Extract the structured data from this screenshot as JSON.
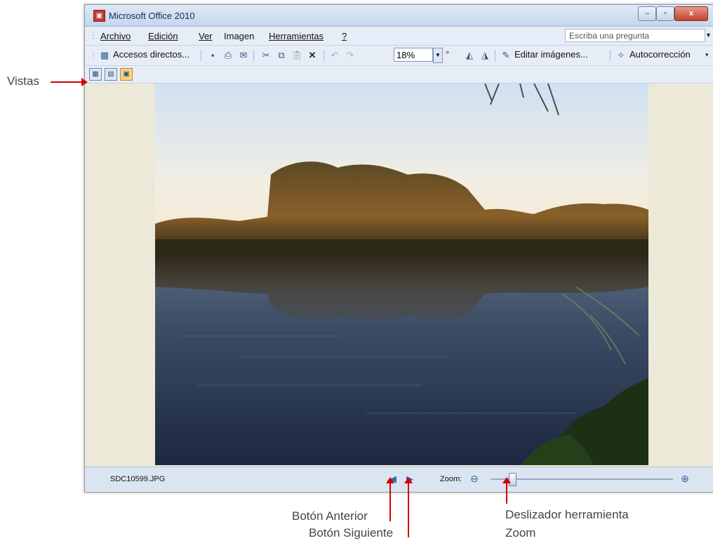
{
  "window": {
    "title": "Microsoft Office 2010",
    "app_icon_glyph": "▣",
    "controls": {
      "minimize": "–",
      "maximize": "▫",
      "close": "x"
    }
  },
  "menu": {
    "items": [
      {
        "label": "Archivo"
      },
      {
        "label": "Edición"
      },
      {
        "label": "Ver"
      },
      {
        "label": "Imagen"
      },
      {
        "label": "Herramientas"
      },
      {
        "label": "?"
      }
    ],
    "search_placeholder": "Escriba una pregunta"
  },
  "toolbar": {
    "shortcuts_label": "Accesos directos...",
    "zoom_value": "18%",
    "edit_images_label": "Editar imágenes...",
    "autocorrect_label": "Autocorrección"
  },
  "status": {
    "filename": "SDC10599.JPG",
    "zoom_label": "Zoom:",
    "zoom_level": 0.12
  },
  "annotations": {
    "views": "Vistas",
    "prev_button": "Botón Anterior",
    "next_button": "Botón Siguiente",
    "zoom_slider_line1": "Deslizador herramienta",
    "zoom_slider_line2": "Zoom"
  },
  "colors": {
    "accent_red": "#d40000",
    "office_blue": "#dbe5f2"
  }
}
